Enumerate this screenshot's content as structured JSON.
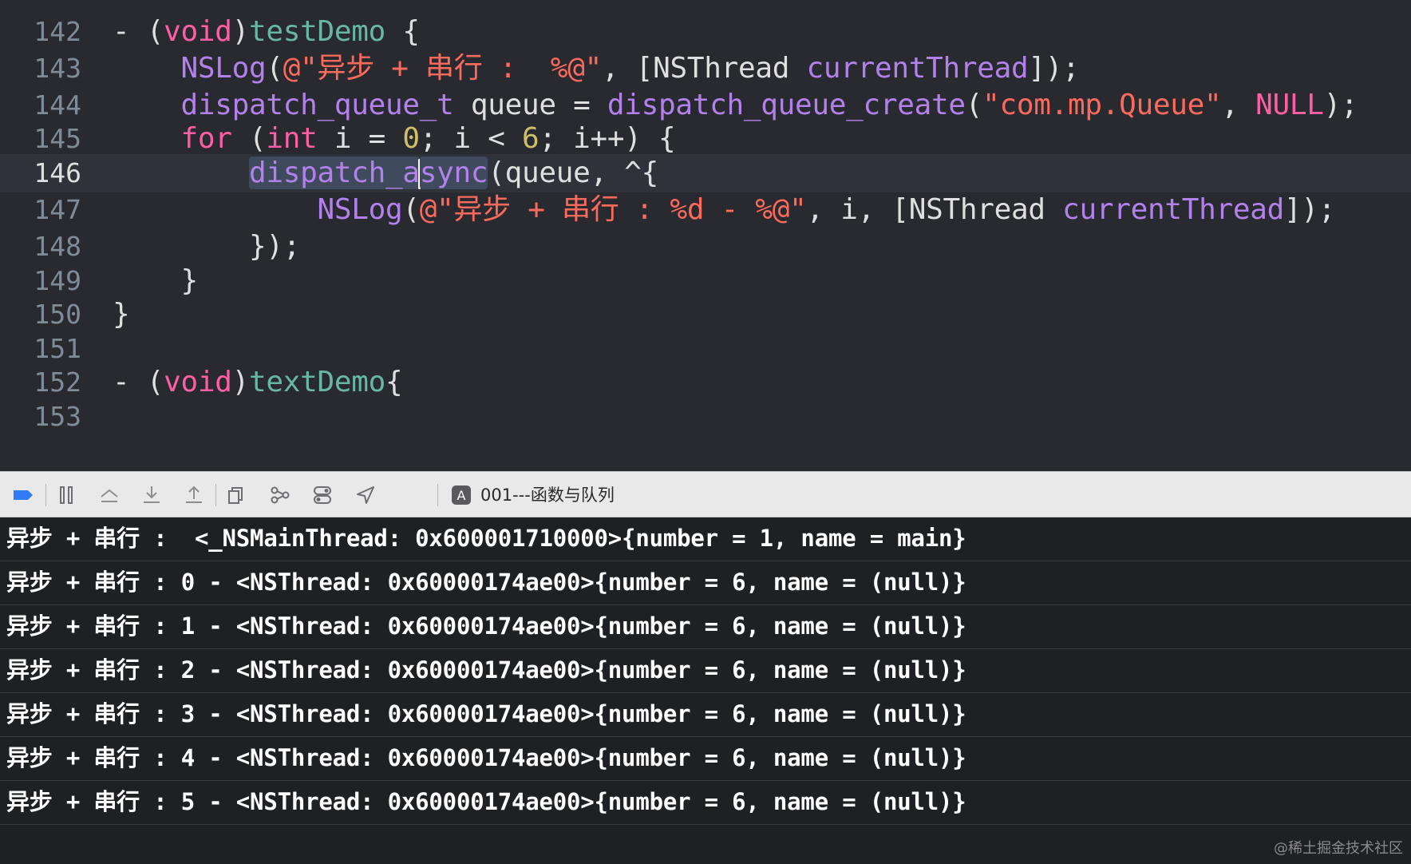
{
  "editor": {
    "lines": [
      {
        "num": "142",
        "current": false,
        "tokens": [
          {
            "t": "- (",
            "c": "plain"
          },
          {
            "t": "void",
            "c": "kw"
          },
          {
            "t": ")",
            "c": "plain"
          },
          {
            "t": "testDemo",
            "c": "fn"
          },
          {
            "t": " {",
            "c": "plain"
          }
        ]
      },
      {
        "num": "143",
        "current": false,
        "tokens": [
          {
            "t": "    ",
            "c": "plain"
          },
          {
            "t": "NSLog",
            "c": "lib"
          },
          {
            "t": "(",
            "c": "plain"
          },
          {
            "t": "@\"异步 + 串行 :  %@\"",
            "c": "str"
          },
          {
            "t": ", [NSThread ",
            "c": "plain"
          },
          {
            "t": "currentThread",
            "c": "lib"
          },
          {
            "t": "]);",
            "c": "plain"
          }
        ]
      },
      {
        "num": "144",
        "current": false,
        "tokens": [
          {
            "t": "    ",
            "c": "plain"
          },
          {
            "t": "dispatch_queue_t",
            "c": "lib"
          },
          {
            "t": " queue = ",
            "c": "plain"
          },
          {
            "t": "dispatch_queue_create",
            "c": "lib"
          },
          {
            "t": "(",
            "c": "plain"
          },
          {
            "t": "\"com.mp.Queue\"",
            "c": "str"
          },
          {
            "t": ", ",
            "c": "plain"
          },
          {
            "t": "NULL",
            "c": "kw"
          },
          {
            "t": ");",
            "c": "plain"
          }
        ]
      },
      {
        "num": "145",
        "current": false,
        "tokens": [
          {
            "t": "    ",
            "c": "plain"
          },
          {
            "t": "for",
            "c": "kw"
          },
          {
            "t": " (",
            "c": "plain"
          },
          {
            "t": "int",
            "c": "kw"
          },
          {
            "t": " i = ",
            "c": "plain"
          },
          {
            "t": "0",
            "c": "num"
          },
          {
            "t": "; i < ",
            "c": "plain"
          },
          {
            "t": "6",
            "c": "num"
          },
          {
            "t": "; i++) {",
            "c": "plain"
          }
        ]
      },
      {
        "num": "146",
        "current": true,
        "tokens": [
          {
            "t": "        ",
            "c": "plain"
          },
          {
            "t": "dispatch_a",
            "c": "lib",
            "sel": true
          },
          {
            "t": "|",
            "c": "cursor"
          },
          {
            "t": "sync",
            "c": "lib",
            "sel": true
          },
          {
            "t": "(queue, ^{",
            "c": "plain"
          }
        ]
      },
      {
        "num": "147",
        "current": false,
        "tokens": [
          {
            "t": "            ",
            "c": "plain"
          },
          {
            "t": "NSLog",
            "c": "lib"
          },
          {
            "t": "(",
            "c": "plain"
          },
          {
            "t": "@\"异步 + 串行 : %d - %@\"",
            "c": "str"
          },
          {
            "t": ", i, [NSThread ",
            "c": "plain"
          },
          {
            "t": "currentThread",
            "c": "lib"
          },
          {
            "t": "]);",
            "c": "plain"
          }
        ]
      },
      {
        "num": "148",
        "current": false,
        "tokens": [
          {
            "t": "        });",
            "c": "plain"
          }
        ]
      },
      {
        "num": "149",
        "current": false,
        "tokens": [
          {
            "t": "    }",
            "c": "plain"
          }
        ]
      },
      {
        "num": "150",
        "current": false,
        "tokens": [
          {
            "t": "}",
            "c": "plain"
          }
        ]
      },
      {
        "num": "151",
        "current": false,
        "tokens": []
      },
      {
        "num": "152",
        "current": false,
        "tokens": [
          {
            "t": "- (",
            "c": "plain"
          },
          {
            "t": "void",
            "c": "kw"
          },
          {
            "t": ")",
            "c": "plain"
          },
          {
            "t": "textDemo",
            "c": "fn"
          },
          {
            "t": "{",
            "c": "plain"
          }
        ]
      },
      {
        "num": "153",
        "current": false,
        "tokens": []
      }
    ]
  },
  "debug_bar": {
    "buttons": [
      {
        "name": "breakpoints-toggle-button",
        "icon": "breakpoint-icon"
      },
      {
        "name": "pause-button",
        "icon": "pause-icon"
      },
      {
        "name": "step-over-button",
        "icon": "step-over-icon"
      },
      {
        "name": "step-into-button",
        "icon": "step-into-icon"
      },
      {
        "name": "step-out-button",
        "icon": "step-out-icon"
      },
      {
        "name": "view-debugger-button",
        "icon": "view-hierarchy-icon"
      },
      {
        "name": "memory-graph-button",
        "icon": "memory-graph-icon"
      },
      {
        "name": "environment-overrides-button",
        "icon": "toggles-icon"
      },
      {
        "name": "simulate-location-button",
        "icon": "location-arrow-icon"
      }
    ],
    "target_name": "001---函数与队列"
  },
  "console": {
    "lines": [
      "异步 + 串行 :  <_NSMainThread: 0x600001710000>{number = 1, name = main}",
      "异步 + 串行 : 0 - <NSThread: 0x60000174ae00>{number = 6, name = (null)}",
      "异步 + 串行 : 1 - <NSThread: 0x60000174ae00>{number = 6, name = (null)}",
      "异步 + 串行 : 2 - <NSThread: 0x60000174ae00>{number = 6, name = (null)}",
      "异步 + 串行 : 3 - <NSThread: 0x60000174ae00>{number = 6, name = (null)}",
      "异步 + 串行 : 4 - <NSThread: 0x60000174ae00>{number = 6, name = (null)}",
      "异步 + 串行 : 5 - <NSThread: 0x60000174ae00>{number = 6, name = (null)}"
    ]
  },
  "watermark": "@稀土掘金技术社区",
  "colors": {
    "editor_bg": "#292a30",
    "current_line_bg": "#2f3239",
    "keyword": "#fc5fa3",
    "function_decl": "#67b7a4",
    "library": "#b281eb",
    "string": "#fc6a5d",
    "number": "#d0bf69",
    "plain": "#dfdfe0",
    "console_bg": "#1f2024",
    "breakpoint_blue": "#2f7cf6"
  }
}
